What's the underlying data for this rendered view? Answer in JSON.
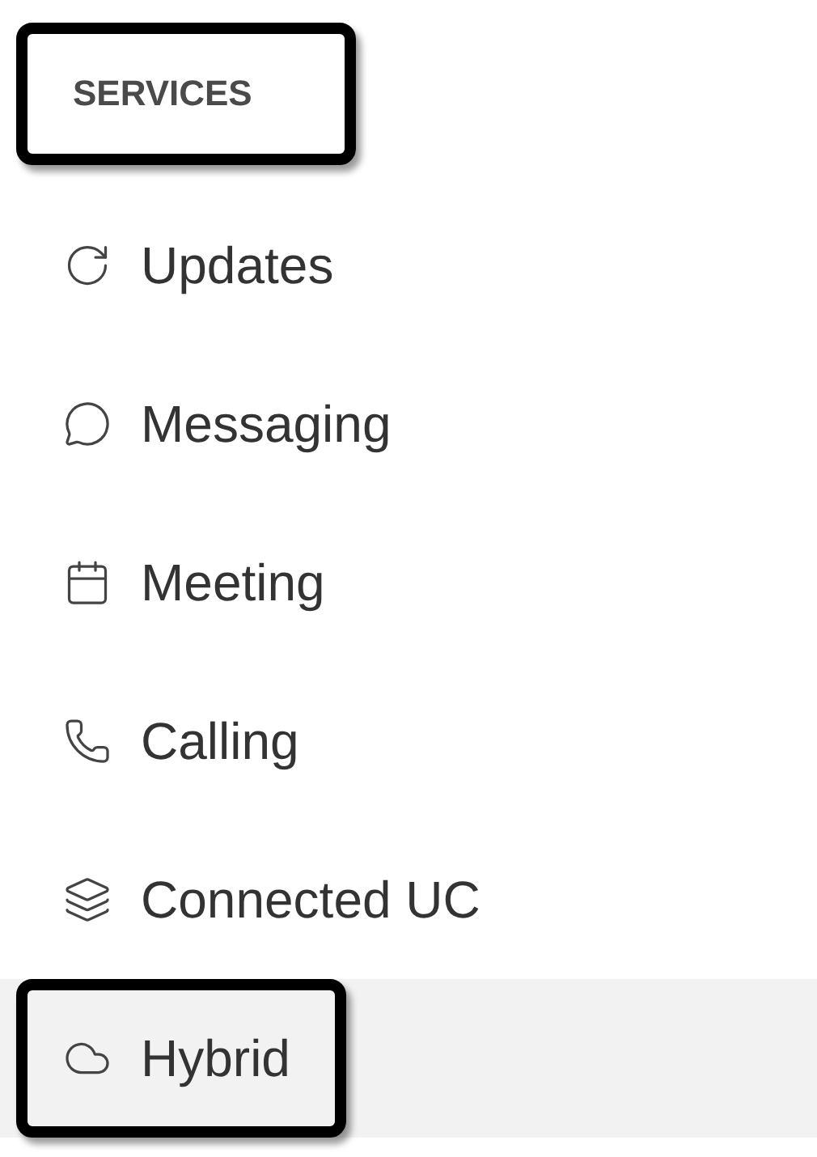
{
  "section": {
    "title": "SERVICES",
    "highlighted": true
  },
  "items": [
    {
      "label": "Updates",
      "selected": false,
      "highlighted": false
    },
    {
      "label": "Messaging",
      "selected": false,
      "highlighted": false
    },
    {
      "label": "Meeting",
      "selected": false,
      "highlighted": false
    },
    {
      "label": "Calling",
      "selected": false,
      "highlighted": false
    },
    {
      "label": "Connected UC",
      "selected": false,
      "highlighted": false
    },
    {
      "label": "Hybrid",
      "selected": true,
      "highlighted": true
    }
  ]
}
